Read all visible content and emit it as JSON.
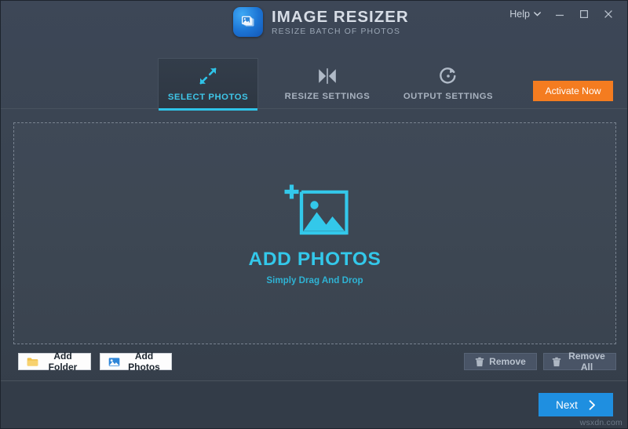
{
  "window": {
    "brand_title": "IMAGE RESIZER",
    "brand_subtitle": "RESIZE BATCH OF PHOTOS",
    "logo_icon": "stacked-photos-icon",
    "help_label": "Help",
    "help_caret_icon": "chevron-down-icon",
    "minimize_icon": "minimize-icon",
    "maximize_icon": "maximize-icon",
    "close_icon": "close-icon",
    "watermark": "wsxdn.com"
  },
  "colors": {
    "accent_cyan": "#33c8ea",
    "accent_orange": "#f47c20",
    "accent_blue": "#1f8fe0",
    "window_bg": "#3a4450",
    "footer_bg": "#333c48",
    "tab_active_bg": "#2e3743",
    "text_muted": "#a8b2bf"
  },
  "tabs": [
    {
      "label": "SELECT PHOTOS",
      "icon": "expand-arrows-icon",
      "active": true
    },
    {
      "label": "RESIZE SETTINGS",
      "icon": "resize-collapse-icon",
      "active": false
    },
    {
      "label": "OUTPUT SETTINGS",
      "icon": "refresh-circle-icon",
      "active": false
    }
  ],
  "header_actions": {
    "activate_label": "Activate Now"
  },
  "dropzone": {
    "icon": "add-photo-frame-icon",
    "title": "ADD PHOTOS",
    "subtitle": "Simply Drag And Drop"
  },
  "toolbar": {
    "add_folder_label": "Add Folder",
    "add_folder_icon": "folder-icon",
    "add_photos_label": "Add Photos",
    "add_photos_icon": "photo-icon",
    "remove_label": "Remove",
    "remove_icon": "trash-icon",
    "remove_all_label": "Remove All",
    "remove_all_icon": "trash-icon"
  },
  "footer": {
    "next_label": "Next",
    "next_icon": "chevron-right-icon"
  }
}
